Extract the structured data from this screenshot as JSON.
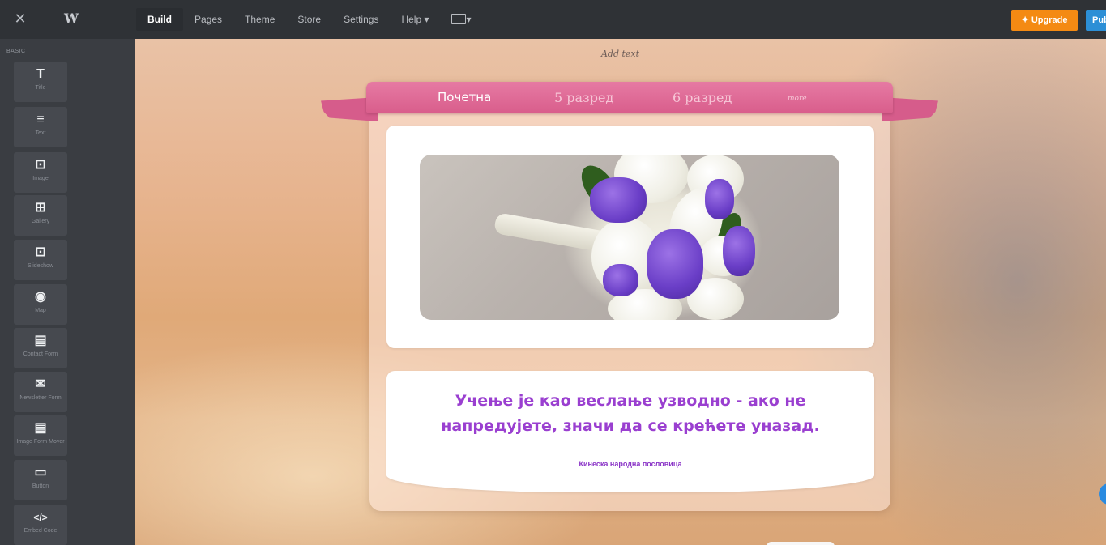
{
  "topbar": {
    "close_icon": "close-icon",
    "logo_icon": "weebly-w-icon",
    "nav": [
      {
        "label": "Build",
        "active": true
      },
      {
        "label": "Pages"
      },
      {
        "label": "Theme"
      },
      {
        "label": "Store"
      },
      {
        "label": "Settings"
      },
      {
        "label": "Help ▾"
      }
    ],
    "device_label": "▾",
    "upgrade_label": "✦ Upgrade",
    "publish_label": "Pub"
  },
  "sidebar": {
    "heading": "BASIC",
    "tiles": [
      {
        "icon": "T",
        "label": "Title"
      },
      {
        "icon": "≡",
        "label": "Text"
      },
      {
        "icon": "⊡",
        "label": "Image"
      },
      {
        "icon": "⊞",
        "label": "Gallery"
      },
      {
        "icon": "⊡",
        "label": "Slideshow"
      },
      {
        "icon": "◉",
        "label": "Map"
      },
      {
        "icon": "▤",
        "label": "Contact Form"
      },
      {
        "icon": "✉",
        "label": "Newsletter Form"
      },
      {
        "icon": "▤",
        "label": "Image Form Mover"
      },
      {
        "icon": "▭",
        "label": "Button"
      },
      {
        "icon": "</>",
        "label": "Embed Code"
      }
    ]
  },
  "canvas": {
    "add_text": "Add text",
    "menu": [
      {
        "label": "Почетна",
        "active": true
      },
      {
        "label": "5 разред"
      },
      {
        "label": "6 разред"
      },
      {
        "label": "more"
      }
    ],
    "quote_line1": "Учење је као веслање узводно - ако не",
    "quote_line2": "напредујете, значи да се крећете уназад.",
    "quote_author": "Кинеска народна пословица"
  },
  "colors": {
    "sidebar_bg": "#3a3d42",
    "topbar_bg": "#2f3236",
    "upgrade": "#f48a13",
    "publish": "#2c8fd6",
    "ribbon": "#d95e8c",
    "quote": "#9a3fd0"
  }
}
